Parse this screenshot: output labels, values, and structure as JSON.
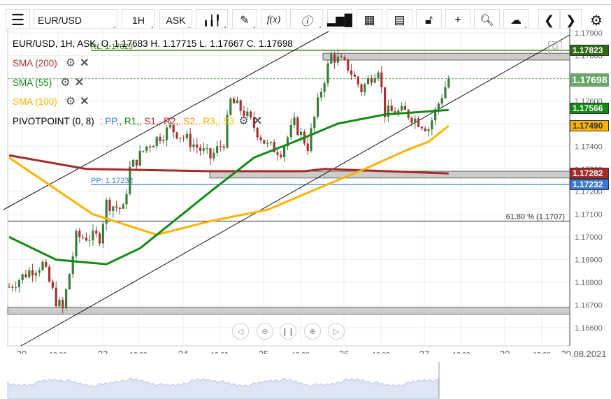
{
  "toolbar": {
    "symbol": "EUR/USD",
    "timeframe": "1H",
    "price_type": "ASK"
  },
  "legend": {
    "ohlc": "EUR/USD, 1H, ASK, O. 1.17683 H. 1.17715 L. 1.17667 C. 1.17698",
    "sma200": "SMA (200)",
    "sma55": "SMA (55)",
    "sma100": "SMA (100)",
    "pivot": "PIVOTPOINT (0, 8)",
    "pivot_items": [
      ": PP,",
      ", R1,",
      ", S1,",
      ", R2,",
      ", S2,",
      ", R3,",
      ", S3"
    ]
  },
  "colors": {
    "up": "#3a7d3a",
    "down": "#a83232",
    "sma200": "#a52a2a",
    "sma55": "#138a13",
    "sma100": "#ffb300",
    "pp": "#3a7bd5",
    "r1": "#4a8a2a"
  },
  "chart_data": {
    "type": "candlestick",
    "y_ticks": [
      "1.17900",
      "1.17800",
      "1.17700",
      "1.17600",
      "1.17500",
      "1.17400",
      "1.17300",
      "1.17200",
      "1.17100",
      "1.17000",
      "1.16900",
      "1.16800",
      "1.16700",
      "1.16600"
    ],
    "ylim": [
      1.1655,
      1.1792
    ],
    "x_ticks": [
      "20",
      "12:00",
      "23",
      "12:00",
      "24",
      "12:00",
      "25",
      "12:00",
      "26",
      "12:00",
      "27",
      "12:00",
      "30",
      "12:00",
      "30.08.2021"
    ],
    "close_path": [
      [
        0,
        1.1678
      ],
      [
        6,
        1.1685
      ],
      [
        10,
        1.1688
      ],
      [
        14,
        1.1672
      ],
      [
        16,
        1.1668
      ],
      [
        20,
        1.17
      ],
      [
        27,
        1.17
      ],
      [
        29,
        1.1715
      ],
      [
        34,
        1.1712
      ],
      [
        36,
        1.173
      ],
      [
        41,
        1.174
      ],
      [
        48,
        1.1748
      ],
      [
        54,
        1.1742
      ],
      [
        60,
        1.1735
      ],
      [
        64,
        1.1742
      ],
      [
        66,
        1.176
      ],
      [
        70,
        1.1755
      ],
      [
        77,
        1.174
      ],
      [
        81,
        1.1738
      ],
      [
        85,
        1.175
      ],
      [
        89,
        1.174
      ],
      [
        93,
        1.1765
      ],
      [
        96,
        1.178
      ],
      [
        101,
        1.1775
      ],
      [
        105,
        1.1765
      ],
      [
        110,
        1.1775
      ],
      [
        112,
        1.1755
      ],
      [
        118,
        1.1755
      ],
      [
        125,
        1.1748
      ],
      [
        131,
        1.177
      ]
    ],
    "sma200": [
      [
        0,
        1.1736
      ],
      [
        23,
        1.173
      ],
      [
        60,
        1.1729
      ],
      [
        88,
        1.1729
      ],
      [
        94,
        1.173
      ],
      [
        131,
        1.1728
      ]
    ],
    "sma100": [
      [
        0,
        1.1735
      ],
      [
        25,
        1.171
      ],
      [
        44,
        1.1701
      ],
      [
        60,
        1.1707
      ],
      [
        77,
        1.1712
      ],
      [
        93,
        1.1722
      ],
      [
        106,
        1.173
      ],
      [
        118,
        1.1738
      ],
      [
        125,
        1.1742
      ],
      [
        131,
        1.1749
      ]
    ],
    "sma55": [
      [
        0,
        1.17
      ],
      [
        14,
        1.169
      ],
      [
        29,
        1.1688
      ],
      [
        39,
        1.1695
      ],
      [
        60,
        1.172
      ],
      [
        73,
        1.1735
      ],
      [
        85,
        1.1742
      ],
      [
        98,
        1.175
      ],
      [
        112,
        1.1754
      ],
      [
        131,
        1.1756
      ]
    ],
    "levels": {
      "r1": "R1: 1.17823",
      "pp": "PP: 1.17232",
      "fib": "61.80 % (1.1707)"
    },
    "tags": {
      "r1": "1.17823",
      "last": "1.17698",
      "sma55": "1.17566",
      "sma100": "1.17490",
      "sma200": "1.17282",
      "pp": "1.17232"
    }
  }
}
